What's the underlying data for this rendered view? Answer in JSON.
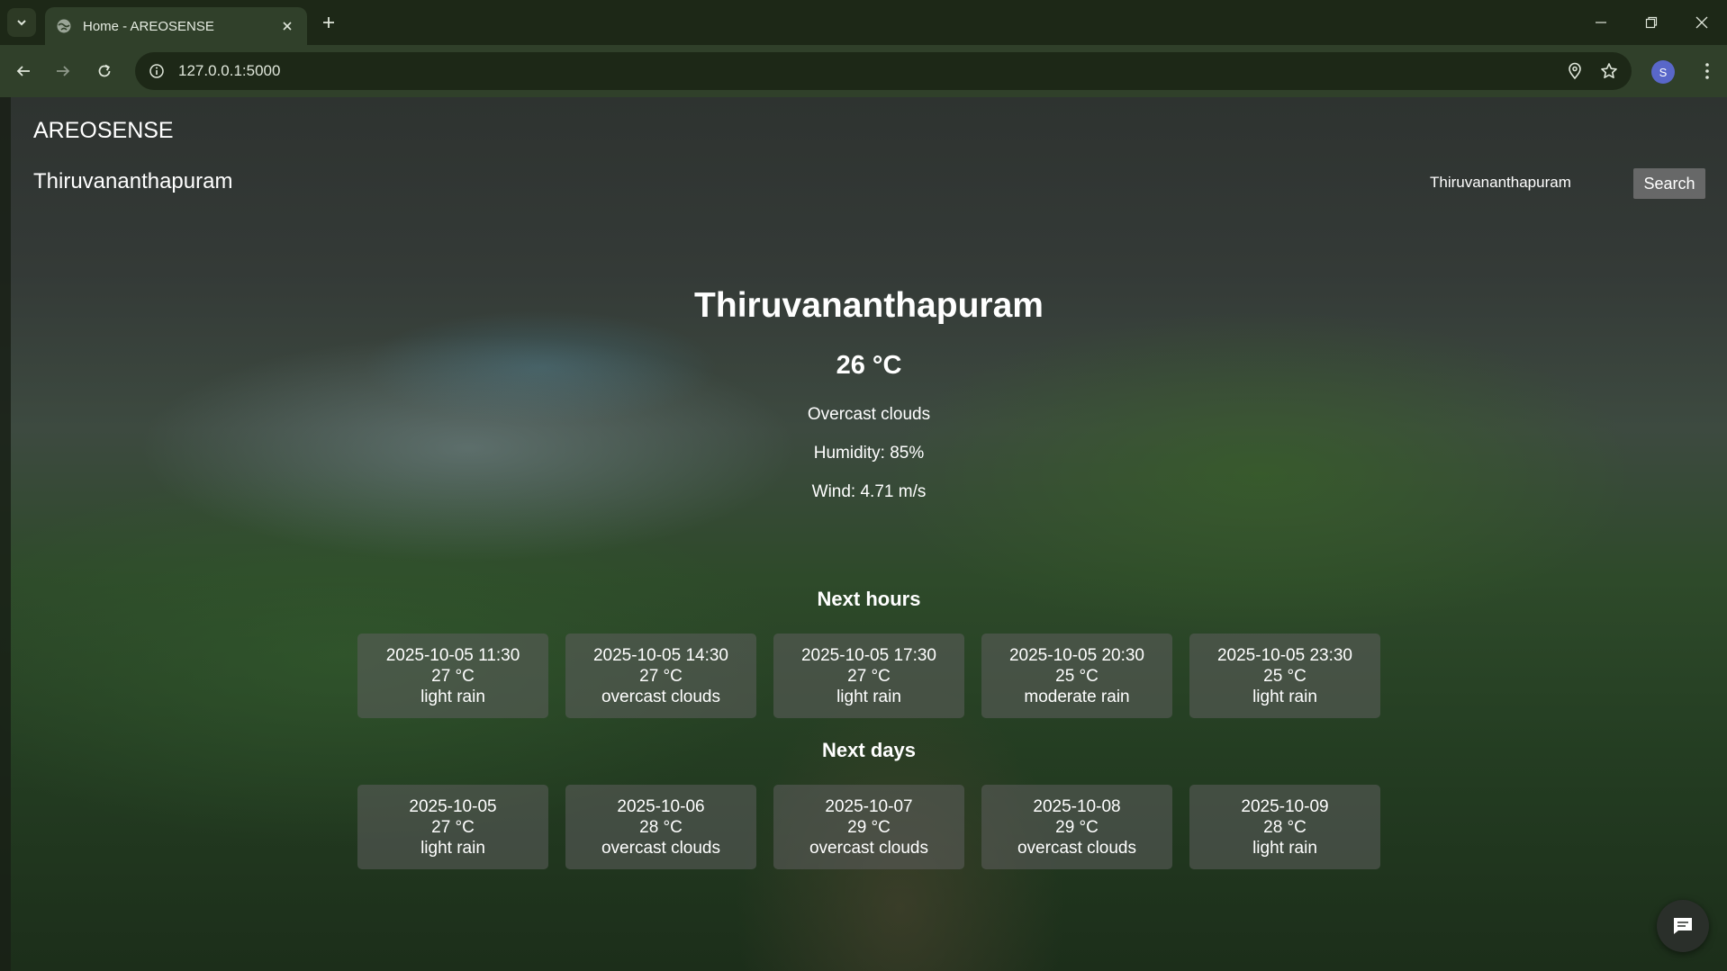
{
  "browser": {
    "tab_title": "Home - AREOSENSE",
    "url": "127.0.0.1:5000",
    "avatar_letter": "S"
  },
  "page": {
    "brand": "AREOSENSE",
    "nav_city": "Thiruvananthapuram",
    "search": {
      "value": "Thiruvananthapuram",
      "button_label": "Search"
    },
    "current": {
      "city": "Thiruvananthapuram",
      "temperature": "26 °C",
      "description": "Overcast clouds",
      "humidity": "Humidity: 85%",
      "wind": "Wind: 4.71 m/s"
    },
    "hours_title": "Next hours",
    "hours": [
      {
        "time": "2025-10-05 11:30",
        "temp": "27 °C",
        "desc": "light rain"
      },
      {
        "time": "2025-10-05 14:30",
        "temp": "27 °C",
        "desc": "overcast clouds"
      },
      {
        "time": "2025-10-05 17:30",
        "temp": "27 °C",
        "desc": "light rain"
      },
      {
        "time": "2025-10-05 20:30",
        "temp": "25 °C",
        "desc": "moderate rain"
      },
      {
        "time": "2025-10-05 23:30",
        "temp": "25 °C",
        "desc": "light rain"
      }
    ],
    "days_title": "Next days",
    "days": [
      {
        "date": "2025-10-05",
        "temp": "27 °C",
        "desc": "light rain"
      },
      {
        "date": "2025-10-06",
        "temp": "28 °C",
        "desc": "overcast clouds"
      },
      {
        "date": "2025-10-07",
        "temp": "29 °C",
        "desc": "overcast clouds"
      },
      {
        "date": "2025-10-08",
        "temp": "29 °C",
        "desc": "overcast clouds"
      },
      {
        "date": "2025-10-09",
        "temp": "28 °C",
        "desc": "light rain"
      }
    ]
  },
  "icons": {
    "tab_list": "chevron-down-icon",
    "favicon": "globe-icon",
    "tab_close": "close-icon",
    "new_tab": "plus-icon",
    "minimize": "minimize-icon",
    "restore": "restore-icon",
    "close_window": "close-icon",
    "back": "arrow-left-icon",
    "forward": "arrow-right-icon",
    "reload": "reload-icon",
    "site_info": "info-icon",
    "location": "location-pin-icon",
    "bookmark": "star-icon",
    "menu": "kebab-menu-icon",
    "chat": "chat-icon"
  }
}
